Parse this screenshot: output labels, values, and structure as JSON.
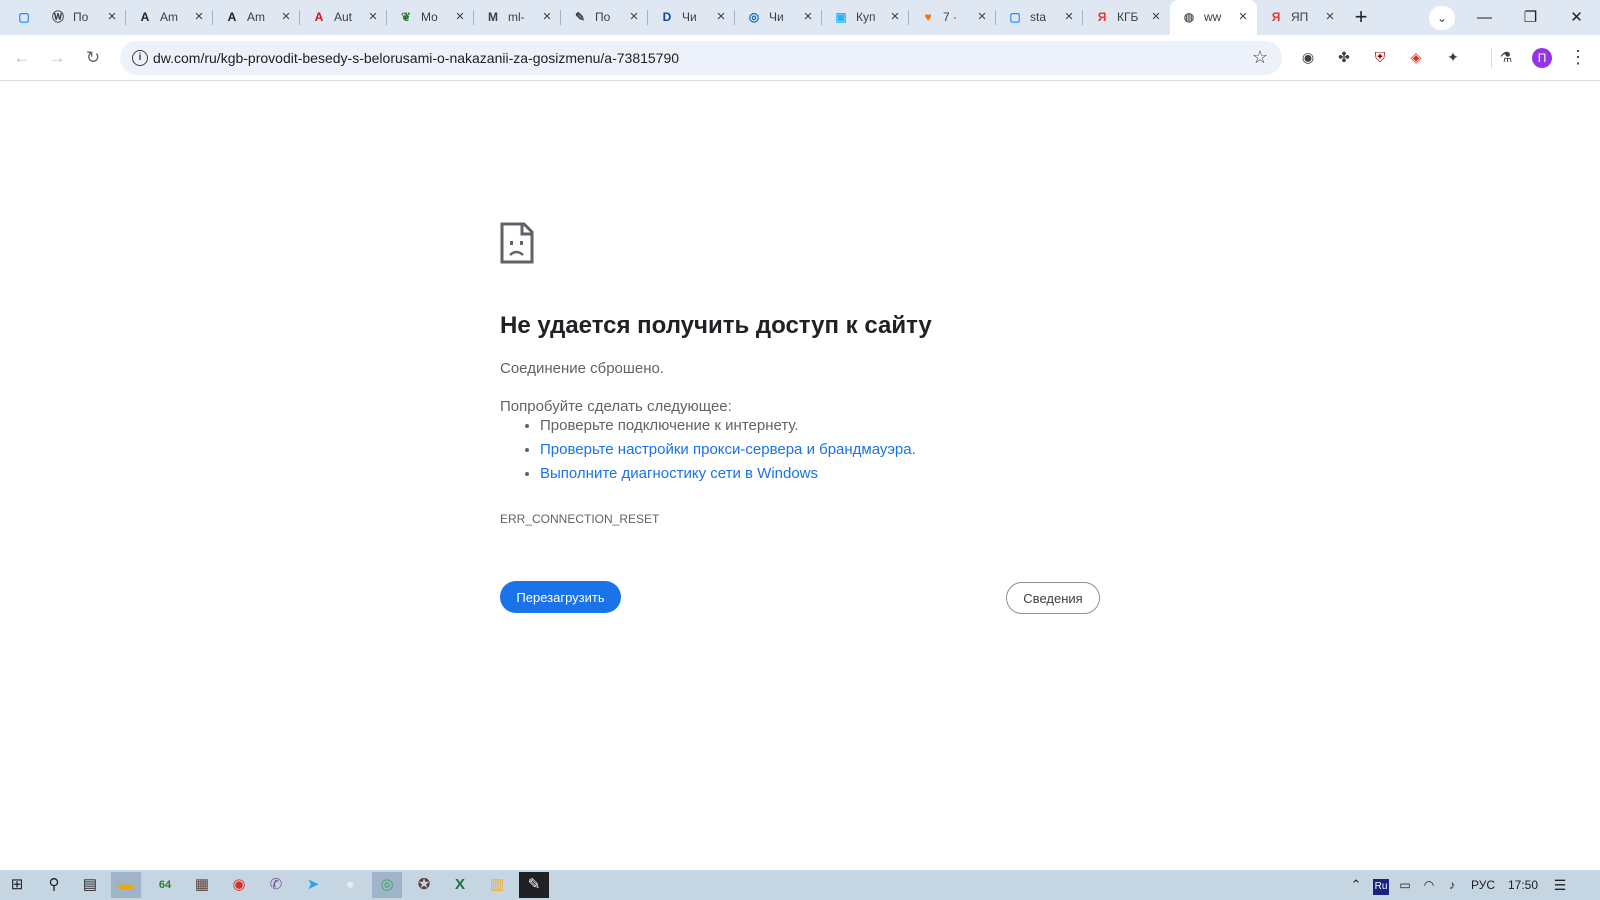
{
  "tabs": [
    {
      "title": "",
      "icon": "square-icon",
      "color": "#1e90ff",
      "glyph": "▢"
    },
    {
      "title": "По",
      "icon": "wordpress-icon",
      "color": "#3c4043",
      "glyph": "Ⓦ"
    },
    {
      "title": "Am",
      "icon": "a-letter-icon",
      "color": "#202124",
      "glyph": "A"
    },
    {
      "title": "Am",
      "icon": "a-letter-icon",
      "color": "#202124",
      "glyph": "A"
    },
    {
      "title": "Aut",
      "icon": "autocad-icon",
      "color": "#d41111",
      "glyph": "A"
    },
    {
      "title": "Мо",
      "icon": "leaf-icon",
      "color": "#2e7d32",
      "glyph": "❦"
    },
    {
      "title": "ml-",
      "icon": "ml-logo-icon",
      "color": "#3c4043",
      "glyph": "M"
    },
    {
      "title": "По",
      "icon": "pen-icon",
      "color": "#3c4043",
      "glyph": "✎"
    },
    {
      "title": "Чи",
      "icon": "dl-logo-icon",
      "color": "#0d47a1",
      "glyph": "D"
    },
    {
      "title": "Чи",
      "icon": "circle-logo-icon",
      "color": "#1565c0",
      "glyph": "◎"
    },
    {
      "title": "Куп",
      "icon": "kupi-icon",
      "color": "#29b6f6",
      "glyph": "▣"
    },
    {
      "title": "7 ·",
      "icon": "heart-icon",
      "color": "#ff6f00",
      "glyph": "♥"
    },
    {
      "title": "sta",
      "icon": "square-icon",
      "color": "#1e90ff",
      "glyph": "▢"
    },
    {
      "title": "КГБ",
      "icon": "yandex-news-icon",
      "color": "#e53935",
      "glyph": "Я"
    },
    {
      "title": "ww",
      "icon": "globe-icon",
      "color": "#5f6368",
      "glyph": "◍"
    },
    {
      "title": "ЯП",
      "icon": "yandex-news-icon",
      "color": "#e53935",
      "glyph": "Я"
    }
  ],
  "active_tab_index": 14,
  "toolbar": {
    "back": "←",
    "forward": "→",
    "reload": "↻",
    "info": "i",
    "url": "dw.com/ru/kgb-provodit-besedy-s-belorusami-o-nakazanii-za-gosizmenu/a-73815790",
    "star": "☆"
  },
  "window": {
    "tab_search": "⌄",
    "minimize": "—",
    "restore": "❐",
    "close": "✕",
    "new_tab": "+",
    "tab_close": "×"
  },
  "extensions": [
    {
      "name": "lens-extension-icon",
      "glyph": "◉"
    },
    {
      "name": "puzzle-piece-leaf-icon",
      "glyph": "✤"
    },
    {
      "name": "ublock-icon",
      "glyph": "⛨"
    },
    {
      "name": "pdf-icon",
      "glyph": "◈"
    },
    {
      "name": "extensions-icon",
      "glyph": "✦"
    },
    {
      "name": "labs-flask-icon",
      "glyph": "⚗"
    }
  ],
  "avatar": "П",
  "menu": "⋮",
  "error": {
    "title": "Не удается получить доступ к сайту",
    "subtitle": "Соединение сброшено.",
    "try_heading": "Попробуйте сделать следующее:",
    "suggestion_1": "Проверьте подключение к интернету.",
    "suggestion_2": "Проверьте настройки прокси-сервера и брандмауэра.",
    "suggestion_3": "Выполните диагностику сети в Windows",
    "code": "ERR_CONNECTION_RESET",
    "reload_button": "Перезагрузить",
    "details_button": "Сведения"
  },
  "taskbar": {
    "apps": [
      {
        "name": "windows-start-icon",
        "glyph": "⊞",
        "color": "#202124"
      },
      {
        "name": "search-icon",
        "glyph": "⚲",
        "color": "#202124"
      },
      {
        "name": "task-view-icon",
        "glyph": "▤",
        "color": "#202124"
      },
      {
        "name": "file-explorer-icon",
        "glyph": "▬",
        "color": "#e6a817"
      },
      {
        "name": "aida64-icon",
        "glyph": "64",
        "color": "#2e7d32"
      },
      {
        "name": "archive-icon",
        "glyph": "▦",
        "color": "#5d4037"
      },
      {
        "name": "chrome-icon",
        "glyph": "◉",
        "color": "#d93025"
      },
      {
        "name": "viber-icon",
        "glyph": "✆",
        "color": "#7b519d"
      },
      {
        "name": "telegram-icon",
        "glyph": "➤",
        "color": "#2aa3e0"
      },
      {
        "name": "blank-app-icon",
        "glyph": "●",
        "color": "#e8eaed"
      },
      {
        "name": "chrome-alt-icon",
        "glyph": "◎",
        "color": "#34a853"
      },
      {
        "name": "game-icon",
        "glyph": "✪",
        "color": "#5d4037"
      },
      {
        "name": "excel-icon",
        "glyph": "X",
        "color": "#1e7145"
      },
      {
        "name": "folder-app-icon",
        "glyph": "▥",
        "color": "#f9a825"
      },
      {
        "name": "acrobat-icon",
        "glyph": "✎",
        "color": "#ffffff"
      }
    ],
    "tray_chevron": "⌃",
    "lang_badge": "Ru",
    "lang": "РУС",
    "time": "17:50",
    "notifications": "☰"
  }
}
